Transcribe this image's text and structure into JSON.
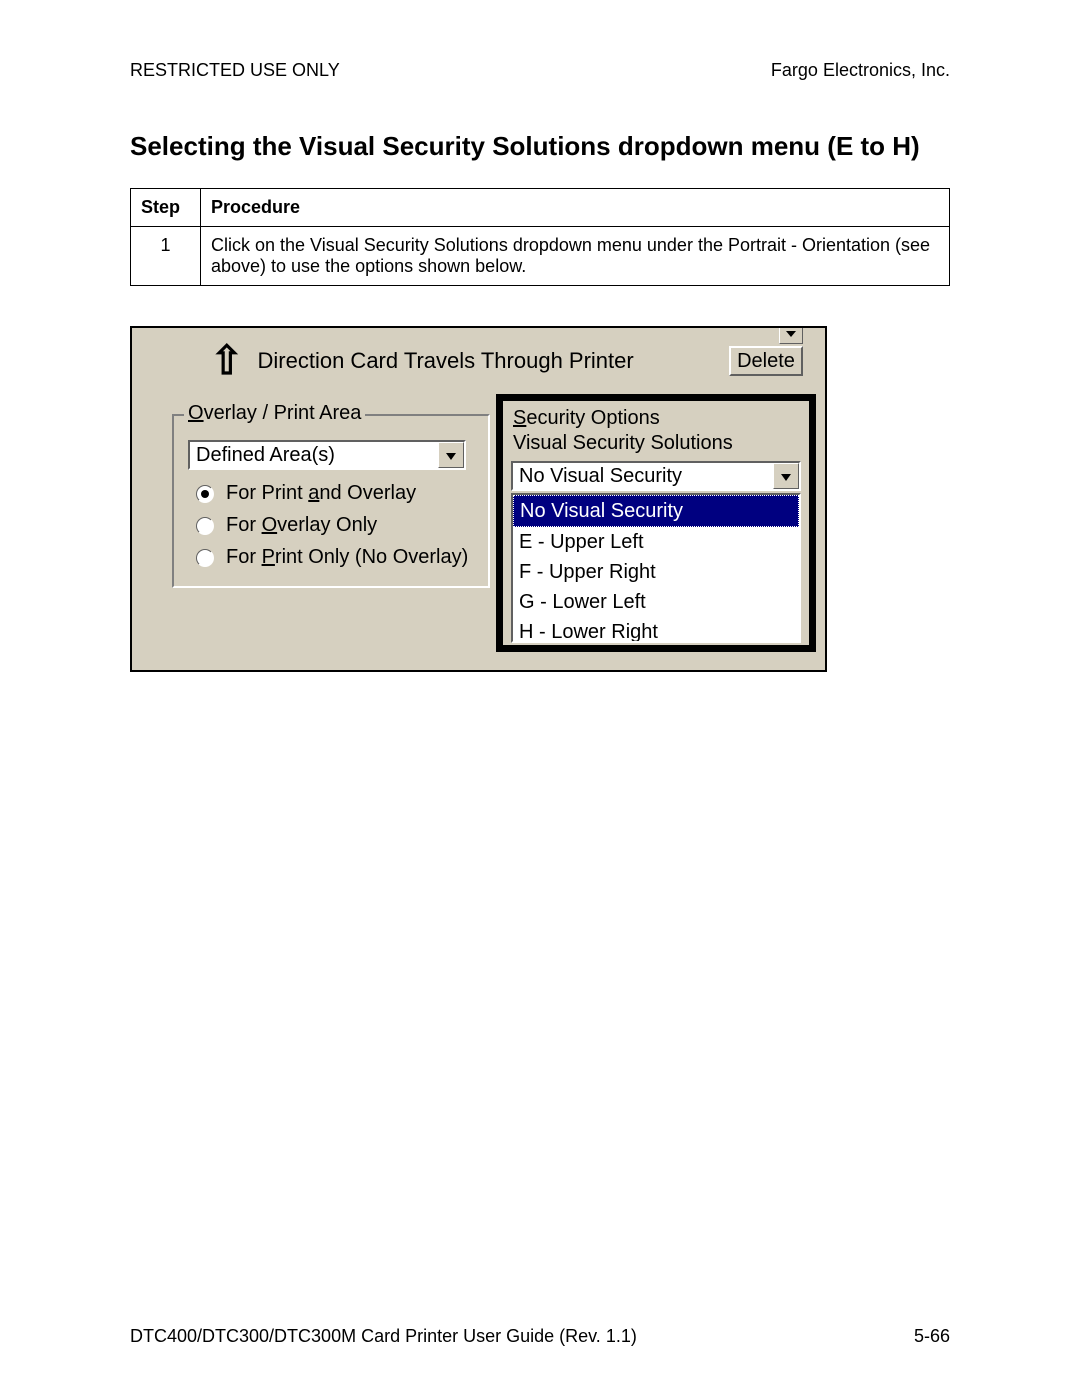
{
  "header": {
    "left": "RESTRICTED USE ONLY",
    "right": "Fargo Electronics, Inc."
  },
  "heading": "Selecting the Visual Security Solutions dropdown menu (E to H)",
  "table": {
    "col_step": "Step",
    "col_proc": "Procedure",
    "rows": [
      {
        "num": "1",
        "text": "Click on the Visual Security Solutions dropdown menu under the Portrait - Orientation (see above) to use the options shown below."
      }
    ]
  },
  "dialog": {
    "direction_label": "Direction Card Travels Through Printer",
    "delete_btn": "Delete",
    "overlay": {
      "legend_pre": "O",
      "legend_post": "verlay / Print Area",
      "combo_value": "Defined Area(s)",
      "radios": {
        "r1_pre": "For Print ",
        "r1_u": "a",
        "r1_post": "nd Overlay",
        "r2_pre": "For ",
        "r2_u": "O",
        "r2_post": "verlay Only",
        "r3_pre": "For ",
        "r3_u": "P",
        "r3_post": "rint Only (No Overlay)"
      }
    },
    "security": {
      "legend_u": "S",
      "legend_post": "ecurity Options",
      "sublabel": "Visual Security Solutions",
      "combo_value": "No Visual Security",
      "options": {
        "o0": "No Visual Security",
        "o1": "E - Upper Left",
        "o2": "F - Upper Right",
        "o3": "G - Lower Left",
        "o4": "H - Lower Right"
      }
    }
  },
  "footer": {
    "left": "DTC400/DTC300/DTC300M Card Printer User Guide (Rev. 1.1)",
    "right": "5-66"
  }
}
